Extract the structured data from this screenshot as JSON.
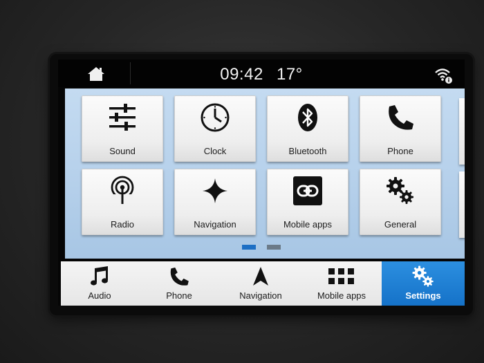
{
  "status": {
    "time": "09:42",
    "temperature": "17°"
  },
  "icons": {
    "home": "home-icon",
    "wifi": "wifi-info-icon"
  },
  "colors": {
    "accent": "#1a7fd4",
    "content_bg": "#b9d2ec",
    "tile_bg": "#f2f2f2"
  },
  "tiles": [
    {
      "label": "Sound",
      "icon": "sliders-icon"
    },
    {
      "label": "Clock",
      "icon": "clock-icon"
    },
    {
      "label": "Bluetooth",
      "icon": "bluetooth-icon"
    },
    {
      "label": "Phone",
      "icon": "phone-icon"
    },
    {
      "label": "Radio",
      "icon": "radio-antenna-icon"
    },
    {
      "label": "Navigation",
      "icon": "star-compass-icon"
    },
    {
      "label": "Mobile apps",
      "icon": "link-icon"
    },
    {
      "label": "General",
      "icon": "gears-icon"
    }
  ],
  "pager": {
    "pages": 2,
    "current": 1
  },
  "tabs": [
    {
      "label": "Audio",
      "icon": "music-note-icon",
      "selected": false
    },
    {
      "label": "Phone",
      "icon": "phone-icon",
      "selected": false
    },
    {
      "label": "Navigation",
      "icon": "navigation-arrow-icon",
      "selected": false
    },
    {
      "label": "Mobile apps",
      "icon": "apps-grid-icon",
      "selected": false
    },
    {
      "label": "Settings",
      "icon": "gears-icon",
      "selected": true
    }
  ]
}
